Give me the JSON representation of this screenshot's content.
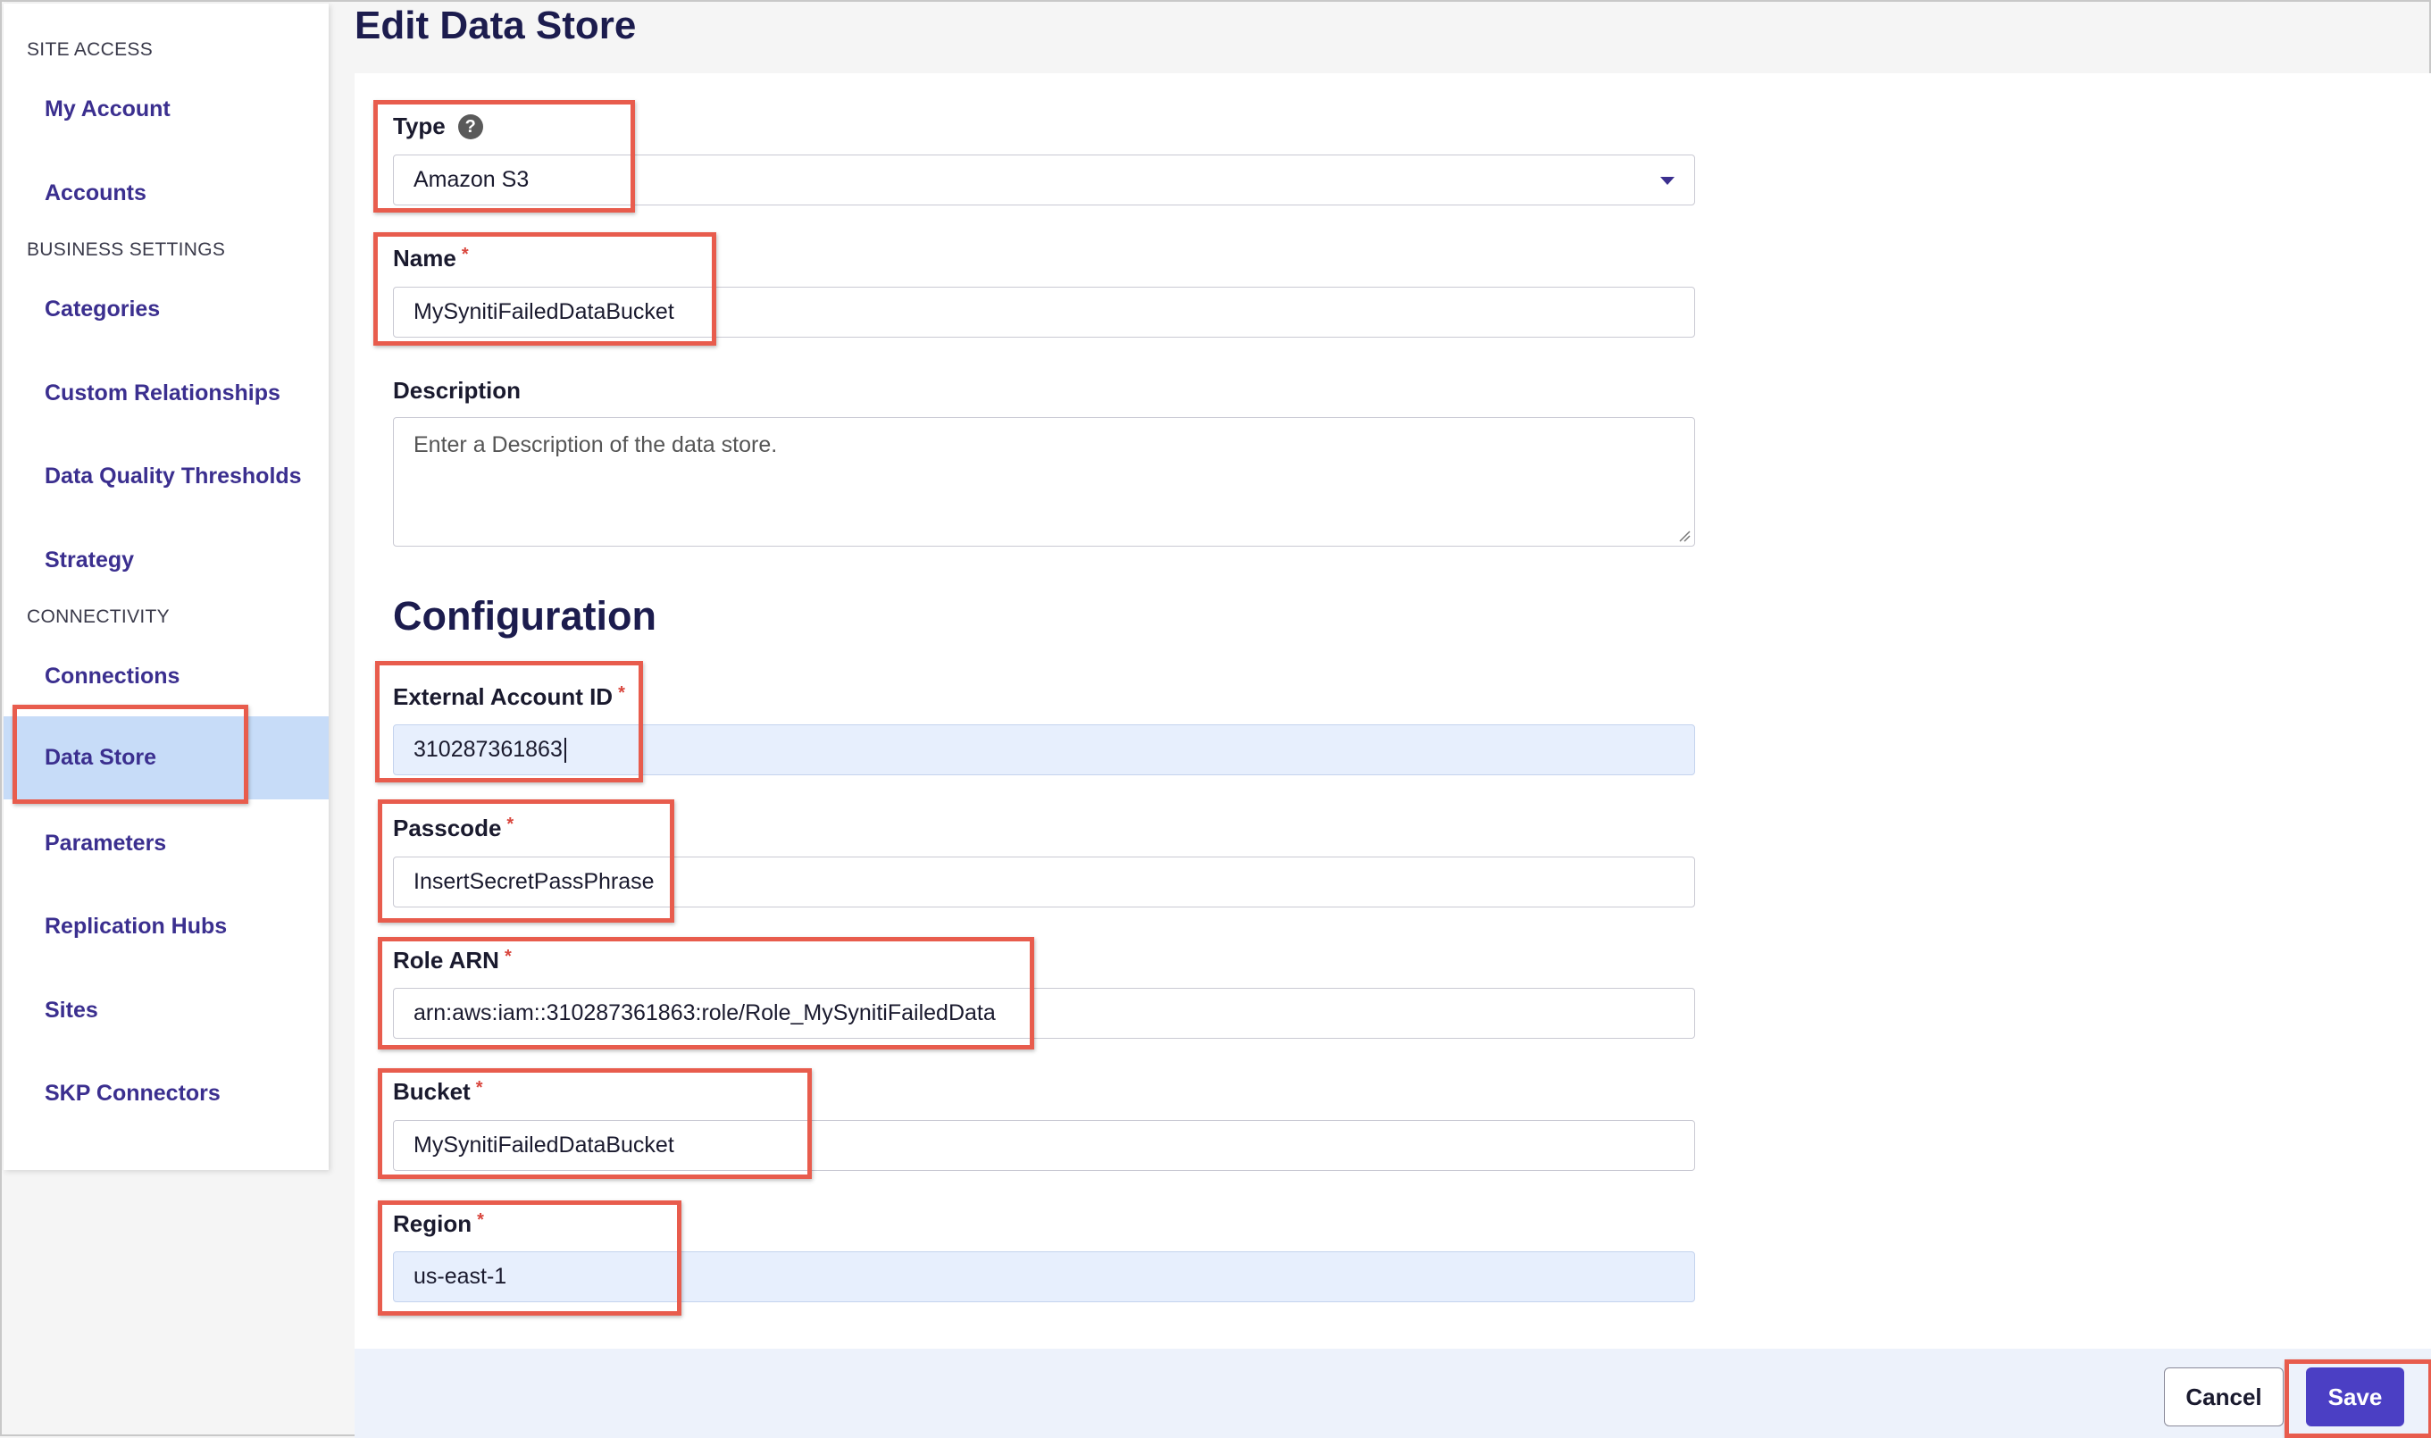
{
  "page": {
    "title": "Edit Data Store"
  },
  "sidebar": {
    "sections": [
      {
        "heading": "SITE ACCESS"
      },
      {
        "heading": "BUSINESS SETTINGS"
      },
      {
        "heading": "CONNECTIVITY"
      }
    ],
    "items": [
      {
        "label": "My Account"
      },
      {
        "label": "Accounts"
      },
      {
        "label": "Categories"
      },
      {
        "label": "Custom Relationships"
      },
      {
        "label": "Data Quality Thresholds"
      },
      {
        "label": "Strategy"
      },
      {
        "label": "Connections"
      },
      {
        "label": "Data Store",
        "active": true
      },
      {
        "label": "Parameters"
      },
      {
        "label": "Replication Hubs"
      },
      {
        "label": "Sites"
      },
      {
        "label": "SKP Connectors"
      }
    ]
  },
  "form": {
    "type": {
      "label": "Type",
      "help": "?",
      "value": "Amazon S3"
    },
    "name": {
      "label": "Name",
      "required": "*",
      "value": "MySynitiFailedDataBucket"
    },
    "description": {
      "label": "Description",
      "placeholder": "Enter a Description of the data store."
    },
    "configuration_heading": "Configuration",
    "external_account_id": {
      "label": "External Account ID",
      "required": "*",
      "value": "310287361863"
    },
    "passcode": {
      "label": "Passcode",
      "required": "*",
      "value": "InsertSecretPassPhrase"
    },
    "role_arn": {
      "label": "Role ARN",
      "required": "*",
      "value": "arn:aws:iam::310287361863:role/Role_MySynitiFailedData"
    },
    "bucket": {
      "label": "Bucket",
      "required": "*",
      "value": "MySynitiFailedDataBucket"
    },
    "region": {
      "label": "Region",
      "required": "*",
      "value": "us-east-1"
    }
  },
  "footer": {
    "cancel_label": "Cancel",
    "save_label": "Save"
  },
  "colors": {
    "accent": "#4b3fc4",
    "nav_text": "#3b2f8f",
    "active_nav_bg": "#c7dcf8",
    "highlight": "#e85c4d",
    "required": "#d9463d"
  }
}
